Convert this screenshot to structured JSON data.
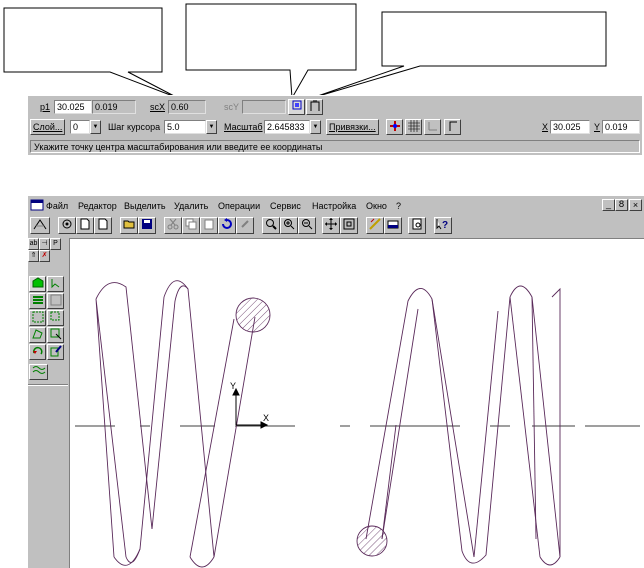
{
  "status_panel": {
    "p1_label": "p1",
    "p1_value": "30.025",
    "p1_second_value": "0.019",
    "scx_label": "scX",
    "scx_value": "0.60",
    "scy_label": "scY",
    "layer_label": "Слой...",
    "layer_value": "0",
    "cursor_step_label": "Шаг курсора",
    "cursor_step_value": "5.0",
    "scale_label": "Масштаб",
    "scale_value": "2.645833",
    "snaps_label": "Привязки...",
    "x_label": "X",
    "x_value": "30.025",
    "y_label": "Y",
    "y_value": "0.019",
    "prompt": "Укажите точку центра масштабирования или введите ее координаты"
  },
  "app_window": {
    "menu": [
      "Файл",
      "Редактор",
      "Выделить",
      "Удалить",
      "Операции",
      "Сервис",
      "Настройка",
      "Окно",
      "?"
    ],
    "window_controls": [
      "_",
      "8",
      "×"
    ]
  },
  "icons": {
    "toolbar": [
      "new-document-icon",
      "open-folder-icon",
      "save-icon",
      "cut-icon",
      "copy-icon",
      "paste-icon",
      "undo-icon",
      "zoom-icon",
      "pan-icon",
      "help-icon"
    ],
    "side": [
      "select-icon",
      "cursor-icon",
      "dimension-icon",
      "edit-icon"
    ]
  },
  "colors": {
    "panel_gray": "#c0c0c0",
    "title_blue": "#000080",
    "drawing_line": "#5a2a5a",
    "highlight_green": "#00c000"
  }
}
